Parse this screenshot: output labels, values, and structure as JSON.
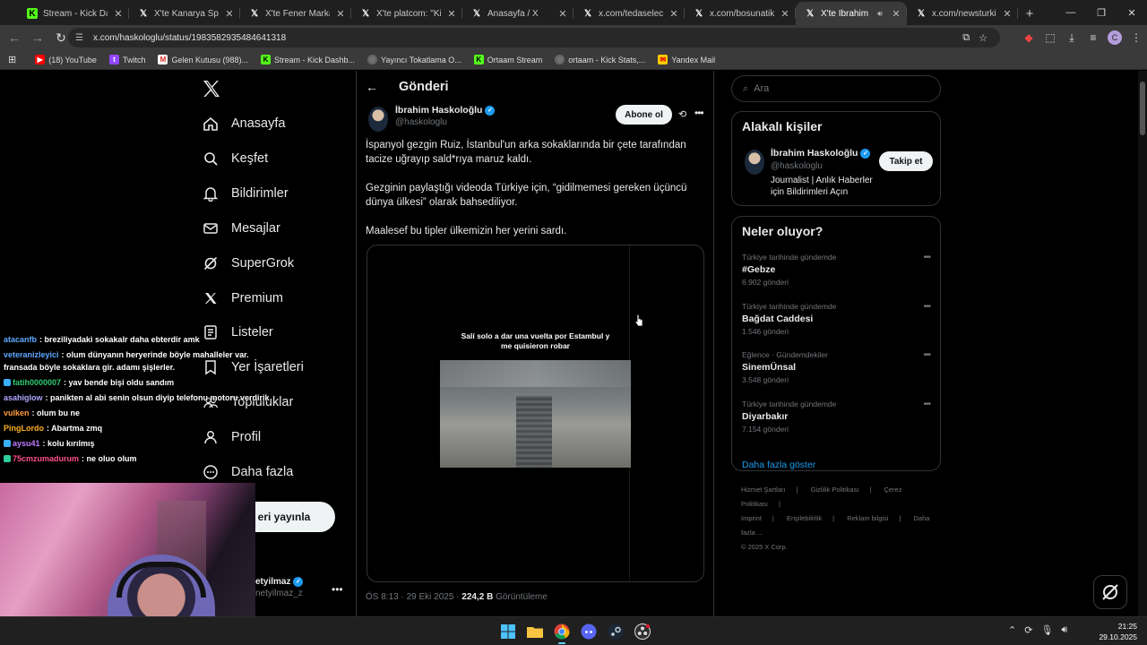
{
  "browser": {
    "tabs": [
      {
        "title": "Stream - Kick Dashbo",
        "icon": "kick-icon",
        "active": false
      },
      {
        "title": "X'te Kanarya Sports: \"",
        "icon": "x-icon",
        "active": false
      },
      {
        "title": "X'te Fener Markaj: \"",
        "icon": "x-icon",
        "active": false
      },
      {
        "title": "X'te platcom: \"Kick'te",
        "icon": "x-icon",
        "active": false
      },
      {
        "title": "Anasayfa / X",
        "icon": "x-icon",
        "active": false
      },
      {
        "title": "x.com/tedaselectrica",
        "icon": "x-icon",
        "active": false
      },
      {
        "title": "x.com/bosunatiklama",
        "icon": "x-icon",
        "active": false
      },
      {
        "title": "X'te İbrahim Hask",
        "icon": "x-icon",
        "active": true
      },
      {
        "title": "x.com/newsturkic/sta",
        "icon": "x-icon",
        "active": false
      }
    ],
    "url": "x.com/haskologlu/status/1983582935484641318",
    "bookmarks": [
      {
        "label": "(18) YouTube",
        "icon": "youtube-icon"
      },
      {
        "label": "Twitch",
        "icon": "twitch-icon"
      },
      {
        "label": "Gelen Kutusu (988)...",
        "icon": "gmail-icon"
      },
      {
        "label": "Stream - Kick Dashb...",
        "icon": "kick-icon"
      },
      {
        "label": "Yayıncı Tokatlama O...",
        "icon": "globe-icon"
      },
      {
        "label": "Ortaam Stream",
        "icon": "kick-icon"
      },
      {
        "label": "ortaam - Kick Stats,...",
        "icon": "globe-icon"
      },
      {
        "label": "Yandex Mail",
        "icon": "yandex-mail-icon"
      }
    ],
    "profile_initial": "C"
  },
  "nav": {
    "items": [
      {
        "label": "Anasayfa",
        "icon": "home-icon"
      },
      {
        "label": "Keşfet",
        "icon": "search-icon"
      },
      {
        "label": "Bildirimler",
        "icon": "bell-icon"
      },
      {
        "label": "Mesajlar",
        "icon": "mail-icon"
      },
      {
        "label": "SuperGrok",
        "icon": "grok-icon"
      },
      {
        "label": "Premium",
        "icon": "x-icon"
      },
      {
        "label": "Listeler",
        "icon": "list-icon"
      },
      {
        "label": "Yer İşaretleri",
        "icon": "bookmark-icon"
      },
      {
        "label": "Topluluklar",
        "icon": "people-icon"
      },
      {
        "label": "Profil",
        "icon": "user-icon"
      },
      {
        "label": "Daha fazla",
        "icon": "more-circle-icon"
      }
    ],
    "post_button": "eri yayınla",
    "account": {
      "name": "etyilmaz",
      "handle": "netyilmaz_z"
    }
  },
  "post": {
    "header": "Gönderi",
    "author_name": "İbrahim Haskoloğlu",
    "author_handle": "@haskologlu",
    "subscribe": "Abone ol",
    "paragraphs": [
      "İspanyol gezgin Ruiz, İstanbul'un arka sokaklarında bir çete tarafından tacize uğrayıp sald*rıya maruz kaldı.",
      "Gezginin paylaştığı videoda Türkiye için, “gidilmemesi gereken üçüncü dünya ülkesi” olarak bahsediliyor.",
      "Maalesef bu tipler ülkemizin her yerini sardı."
    ],
    "video_caption": "Salí solo a dar una vuelta por Estambul y me quisieron robar",
    "meta_time": "ÖS 8:13 · 29 Eki 2025 · ",
    "meta_views_count": "224,2 B",
    "meta_views_label": " Görüntüleme"
  },
  "sidebar": {
    "search_placeholder": "Ara",
    "related_title": "Alakalı kişiler",
    "related": {
      "name": "İbrahim Haskoloğlu",
      "handle": "@haskologlu",
      "bio": "Journalist | Anlık Haberler için Bildirimleri Açın",
      "follow": "Takip et"
    },
    "trends_title": "Neler oluyor?",
    "trends": [
      {
        "context": "Türkiye tarihinde gündemde",
        "name": "#Gebze",
        "posts": "6.902 gönderi"
      },
      {
        "context": "Türkiye tarihinde gündemde",
        "name": "Bağdat Caddesi",
        "posts": "1.546 gönderi"
      },
      {
        "context": "Eğlence · Gündemdekiler",
        "name": "SinemÜnsal",
        "posts": "3.548 gönderi"
      },
      {
        "context": "Türkiye tarihinde gündemde",
        "name": "Diyarbakır",
        "posts": "7.154 gönderi"
      }
    ],
    "show_more": "Daha fazla göster",
    "footer": [
      "Hizmet Şartları",
      "Gizlilik Politikası",
      "Çerez Politikası",
      "Imprint",
      "Erişilebilirlik",
      "Reklam bilgisi",
      "Daha fazla ...",
      "© 2025 X Corp."
    ]
  },
  "chat": [
    {
      "user": "atacanfb",
      "color": "#5fa8ff",
      "msg": ": breziliyadaki sokakalr daha ebterdir amk"
    },
    {
      "user": "veteranizleyici",
      "color": "#5fa8ff",
      "msg": ": olum dünyanın heryerinde böyle mahalleler var. fransada böyle sokaklara gir. adamı şişlerler."
    },
    {
      "user": "fatih0000007",
      "color": "#2ecc71",
      "msg": ": yav bende bişi oldu sandım"
    },
    {
      "user": "asahiglow",
      "color": "#b0a8ff",
      "msg": ": panikten al abi senin olsun diyip telefonu motoru verdirik"
    },
    {
      "user": "vulken",
      "color": "#ff9b3a",
      "msg": ": olum bu ne"
    },
    {
      "user": "PingLordo",
      "color": "#ffb020",
      "msg": ": Abartma zmq"
    },
    {
      "user": "aysu41",
      "color": "#c07bff",
      "msg": ": kolu kırılmış"
    },
    {
      "user": "75cmzumadurum",
      "color": "#ff4f8b",
      "msg": ": ne oluo olum"
    }
  ],
  "taskbar": {
    "time": "21:25",
    "date": "29.10.2025"
  }
}
